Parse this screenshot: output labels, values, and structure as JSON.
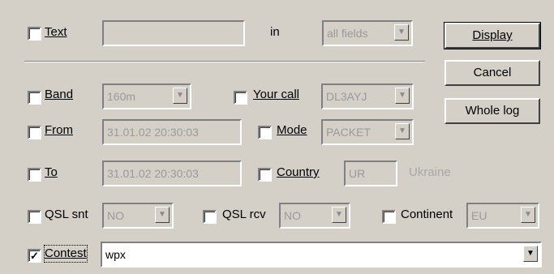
{
  "text_row": {
    "label": "Text",
    "checked": false,
    "value": "",
    "in_label": "in",
    "in_field_value": "all fields"
  },
  "band_row": {
    "label": "Band",
    "value": "160m",
    "your_call_label": "Your call",
    "your_call_value": "DL3AYJ"
  },
  "from_row": {
    "label": "From",
    "value": "31.01.02 20:30:03",
    "mode_label": "Mode",
    "mode_value": "PACKET"
  },
  "to_row": {
    "label": "To",
    "value": "31.01.02 20:30:03",
    "country_label": "Country",
    "country_value": "UR",
    "country_name": "Ukraine"
  },
  "qsl_row": {
    "qsl_sent_label": "QSL snt",
    "qsl_sent_value": "NO",
    "qsl_rcv_label": "QSL rcv",
    "qsl_rcv_value": "NO",
    "continent_label": "Continent",
    "continent_value": "EU"
  },
  "contest_row": {
    "label": "Contest",
    "checked": true,
    "value": "wpx"
  },
  "buttons": {
    "display": "Display",
    "cancel": "Cancel",
    "whole_log": "Whole log"
  },
  "icons": {
    "dropdown": "chevron-down-icon",
    "check": "check-icon"
  },
  "symbols": {
    "check": "✓",
    "arrow": "▼"
  }
}
